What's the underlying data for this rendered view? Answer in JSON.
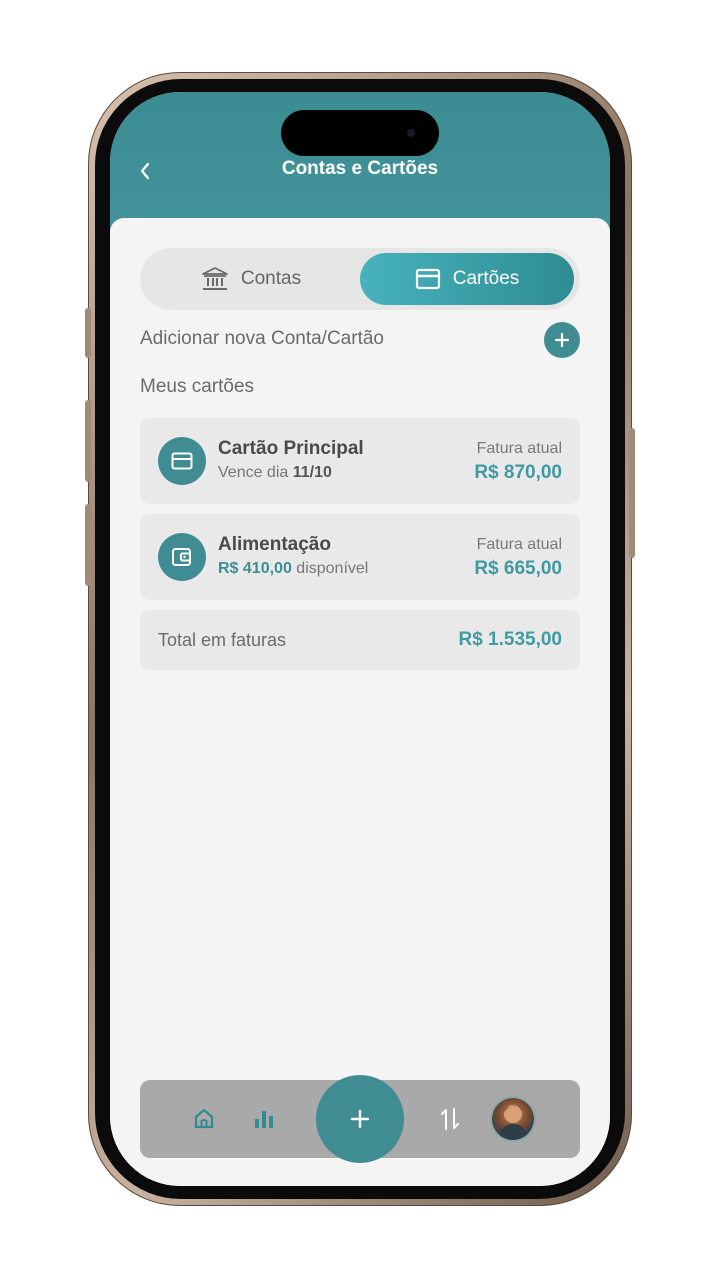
{
  "header": {
    "title": "Contas e Cartões",
    "back_icon": "chevron-left-icon"
  },
  "tabs": [
    {
      "label": "Contas",
      "icon": "bank-icon",
      "active": false
    },
    {
      "label": "Cartões",
      "icon": "credit-card-icon",
      "active": true
    }
  ],
  "add_row": {
    "label": "Adicionar nova Conta/Cartão",
    "icon": "plus-icon"
  },
  "section_title": "Meus cartões",
  "cards": [
    {
      "name": "Cartão Principal",
      "icon": "credit-card-icon",
      "sub_prefix": "Vence dia ",
      "sub_value": "11/10",
      "bill_label": "Fatura atual",
      "bill_value": "R$ 870,00"
    },
    {
      "name": "Alimentação",
      "icon": "wallet-icon",
      "sub_value": "R$ 410,00",
      "sub_suffix": " disponível",
      "bill_label": "Fatura atual",
      "bill_value": "R$ 665,00"
    }
  ],
  "total": {
    "label": "Total em faturas",
    "value": "R$ 1.535,00"
  },
  "bottom_nav": {
    "items": [
      "home-icon",
      "bar-chart-icon",
      "plus-icon",
      "transfer-arrows-icon",
      "avatar"
    ]
  },
  "colors": {
    "accent": "#3f8d93",
    "header": "#3b8c92",
    "value_teal": "#3f9aa1",
    "background": "#f4f4f4"
  }
}
